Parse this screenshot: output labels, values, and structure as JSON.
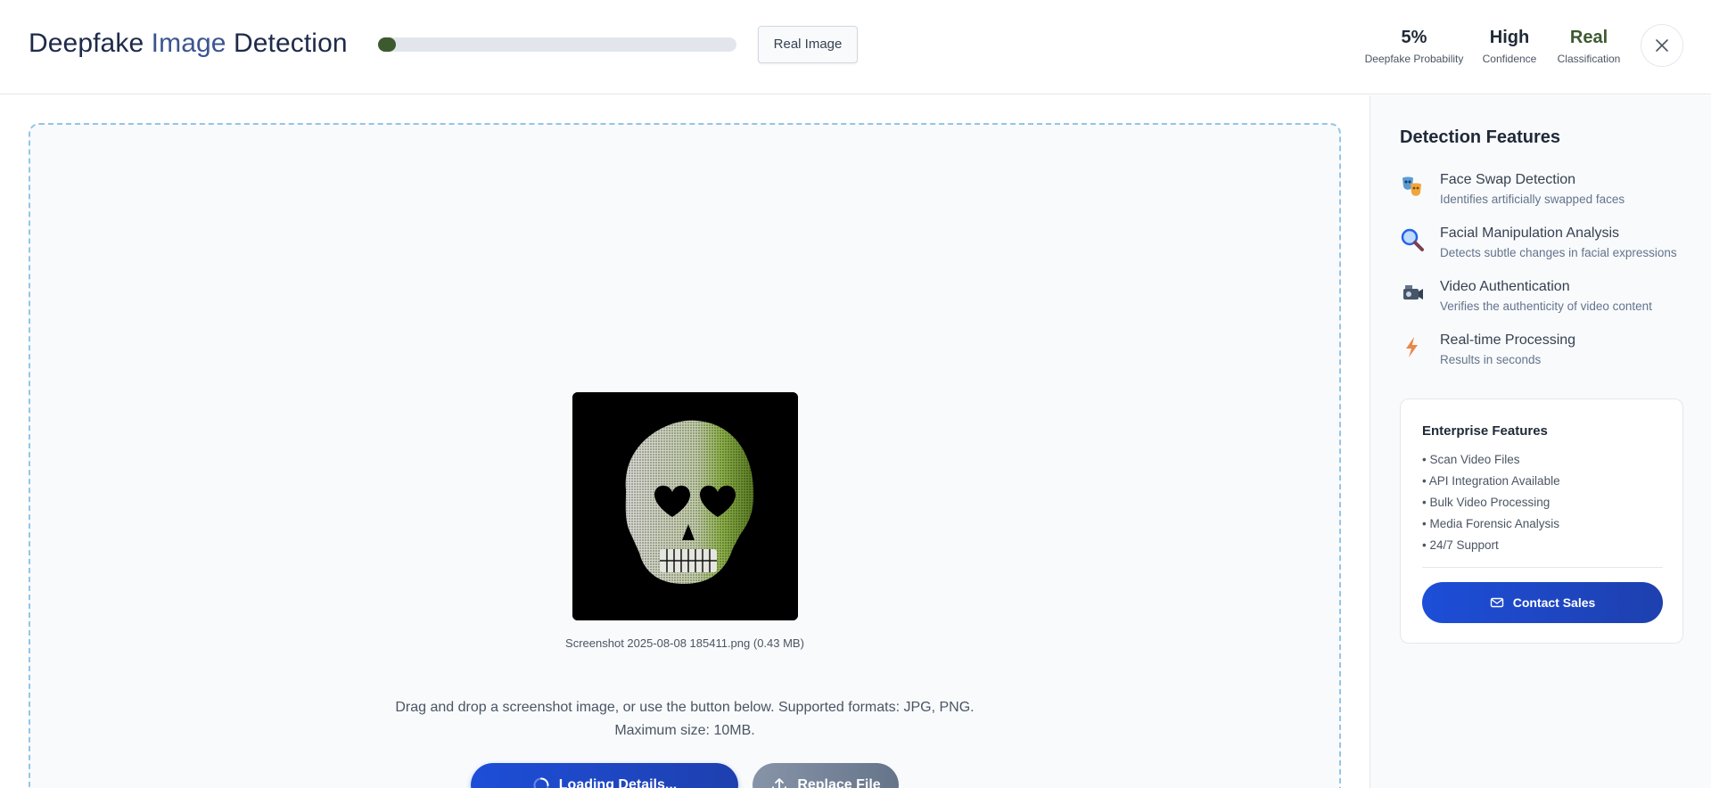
{
  "header": {
    "title_part1": "Deepfake",
    "title_part2": "Image",
    "title_part3": "Detection",
    "progress_percent": 5,
    "progress_color": "#3d5a2f",
    "result_button_label": "Real Image",
    "stats": [
      {
        "value": "5%",
        "label": "Deepfake Probability"
      },
      {
        "value": "High",
        "label": "Confidence"
      },
      {
        "value": "Real",
        "label": "Classification"
      }
    ],
    "close_icon": "close-icon"
  },
  "upload": {
    "filename": "Screenshot 2025-08-08 185411.png (0.43 MB)",
    "help_line1": "Drag and drop a screenshot image, or use the button below. Supported formats: JPG, PNG.",
    "help_line2": "Maximum size: 10MB.",
    "primary_button_label": "Loading Details...",
    "secondary_button_label": "Replace File",
    "preview_image": "skull-with-heart-eyes"
  },
  "sidebar": {
    "title": "Detection Features",
    "features": [
      {
        "name": "Face Swap Detection",
        "description": "Identifies artificially swapped faces",
        "icon": "masks-icon"
      },
      {
        "name": "Facial Manipulation Analysis",
        "description": "Detects subtle changes in facial expressions",
        "icon": "magnifier-icon"
      },
      {
        "name": "Video Authentication",
        "description": "Verifies the authenticity of video content",
        "icon": "video-camera-icon"
      },
      {
        "name": "Real-time Processing",
        "description": "Results in seconds",
        "icon": "lightning-icon"
      }
    ],
    "enterprise": {
      "title": "Enterprise Features",
      "items": [
        "• Scan Video Files",
        "• API Integration Available",
        "• Bulk Video Processing",
        "• Media Forensic Analysis",
        "• 24/7 Support"
      ],
      "contact_label": "Contact Sales"
    }
  },
  "colors": {
    "accent_blue": "#1d4ed8",
    "real_green": "#3d5a2f",
    "dashed_border": "#93c5e8"
  }
}
